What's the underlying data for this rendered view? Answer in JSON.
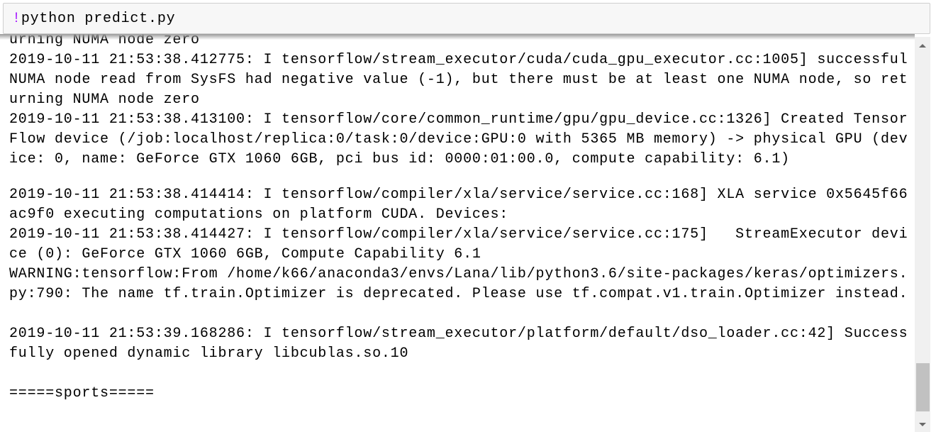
{
  "input": {
    "bang": "!",
    "command": "python predict.py"
  },
  "output_lines": [
    "urning NUMA node zero",
    "2019-10-11 21:53:38.412775: I tensorflow/stream_executor/cuda/cuda_gpu_executor.cc:1005] successful",
    "NUMA node read from SysFS had negative value (-1), but there must be at least one NUMA node, so ret",
    "urning NUMA node zero",
    "2019-10-11 21:53:38.413100: I tensorflow/core/common_runtime/gpu/gpu_device.cc:1326] Created Tensor",
    "Flow device (/job:localhost/replica:0/task:0/device:GPU:0 with 5365 MB memory) -> physical GPU (dev",
    "ice: 0, name: GeForce GTX 1060 6GB, pci bus id: 0000:01:00.0, compute capability: 6.1)",
    "",
    "2019-10-11 21:53:38.414414: I tensorflow/compiler/xla/service/service.cc:168] XLA service 0x5645f66",
    "ac9f0 executing computations on platform CUDA. Devices:",
    "2019-10-11 21:53:38.414427: I tensorflow/compiler/xla/service/service.cc:175]   StreamExecutor devi",
    "ce (0): GeForce GTX 1060 6GB, Compute Capability 6.1",
    "WARNING:tensorflow:From /home/k66/anaconda3/envs/Lana/lib/python3.6/site-packages/keras/optimizers.",
    "py:790: The name tf.train.Optimizer is deprecated. Please use tf.compat.v1.train.Optimizer instead.",
    "",
    "2019-10-11 21:53:39.168286: I tensorflow/stream_executor/platform/default/dso_loader.cc:42] Success",
    "fully opened dynamic library libcublas.so.10",
    "",
    "=====sports====="
  ]
}
